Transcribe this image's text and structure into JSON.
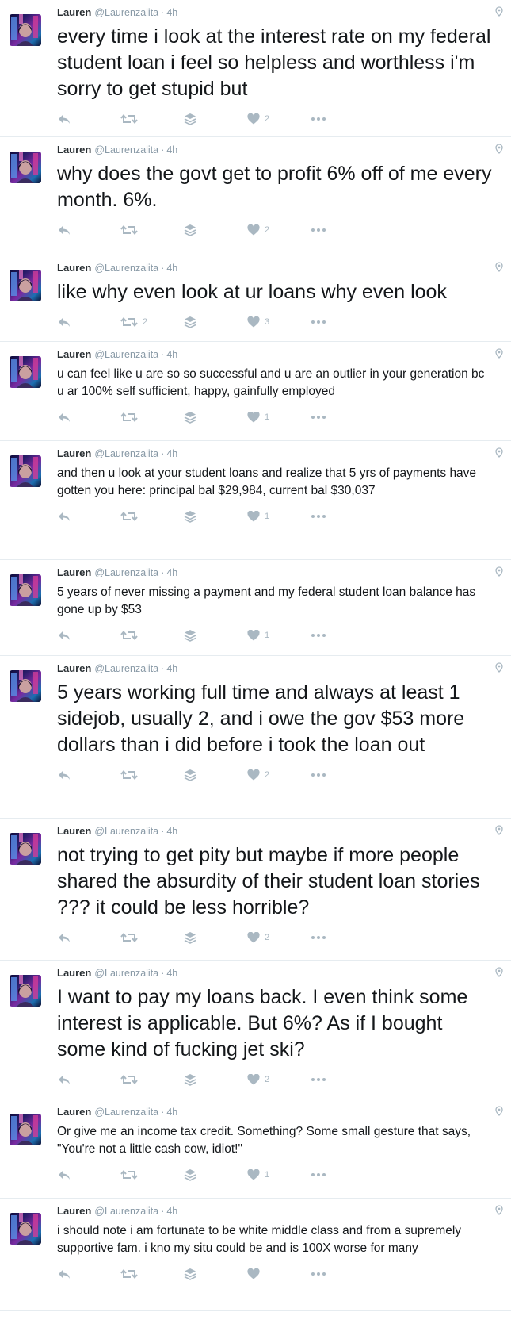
{
  "author": {
    "name": "Lauren",
    "handle": "@Laurenzalita",
    "separator": "·",
    "time": "4h"
  },
  "colors": {
    "text": "#14171a",
    "muted": "#8899a6",
    "icon": "#aab8c2",
    "divider": "#e6ecf0"
  },
  "icons": [
    "reply-icon",
    "retweet-icon",
    "stack-icon",
    "like-icon",
    "more-icon",
    "location-pin-icon"
  ],
  "tweets": [
    {
      "text": "every time i look at the interest rate on my federal student loan i feel so helpless and worthless i'm sorry to get stupid but",
      "retweets": "",
      "likes": "2"
    },
    {
      "text": "why does the govt get to profit 6% off of me every month. 6%.",
      "retweets": "",
      "likes": "2"
    },
    {
      "text": "like why even look at ur loans why even look",
      "retweets": "2",
      "likes": "3"
    },
    {
      "text": "u can feel like u are so so successful and u are an outlier in your generation bc u ar 100% self sufficient, happy, gainfully employed",
      "retweets": "",
      "likes": "1"
    },
    {
      "text": "and then u look at your student loans and realize that 5 yrs of payments have gotten you here: principal bal $29,984, current bal $30,037",
      "retweets": "",
      "likes": "1"
    },
    {
      "text": "5 years of never missing a payment and my federal student loan balance has gone up by $53",
      "retweets": "",
      "likes": "1"
    },
    {
      "text": "5 years working full time and always at least 1 sidejob, usually 2, and i owe the gov $53 more dollars than i did before i took the loan out",
      "retweets": "",
      "likes": "2"
    },
    {
      "text": "not trying to get pity but maybe if more people shared the absurdity of their student loan stories ??? it could be less horrible?",
      "retweets": "",
      "likes": "2"
    },
    {
      "text": "I want to pay my loans back. I even think some interest is applicable. But 6%? As if I bought some kind of fucking jet ski?",
      "retweets": "",
      "likes": "2"
    },
    {
      "text": "Or give me an income tax credit. Something? Some small gesture that says, \"You're not a little cash cow, idiot!\"",
      "retweets": "",
      "likes": "1"
    },
    {
      "text": "i should note i am fortunate to be white middle class and from a supremely supportive fam. i kno my situ could be and is 100X worse for many",
      "retweets": "",
      "likes": ""
    }
  ]
}
